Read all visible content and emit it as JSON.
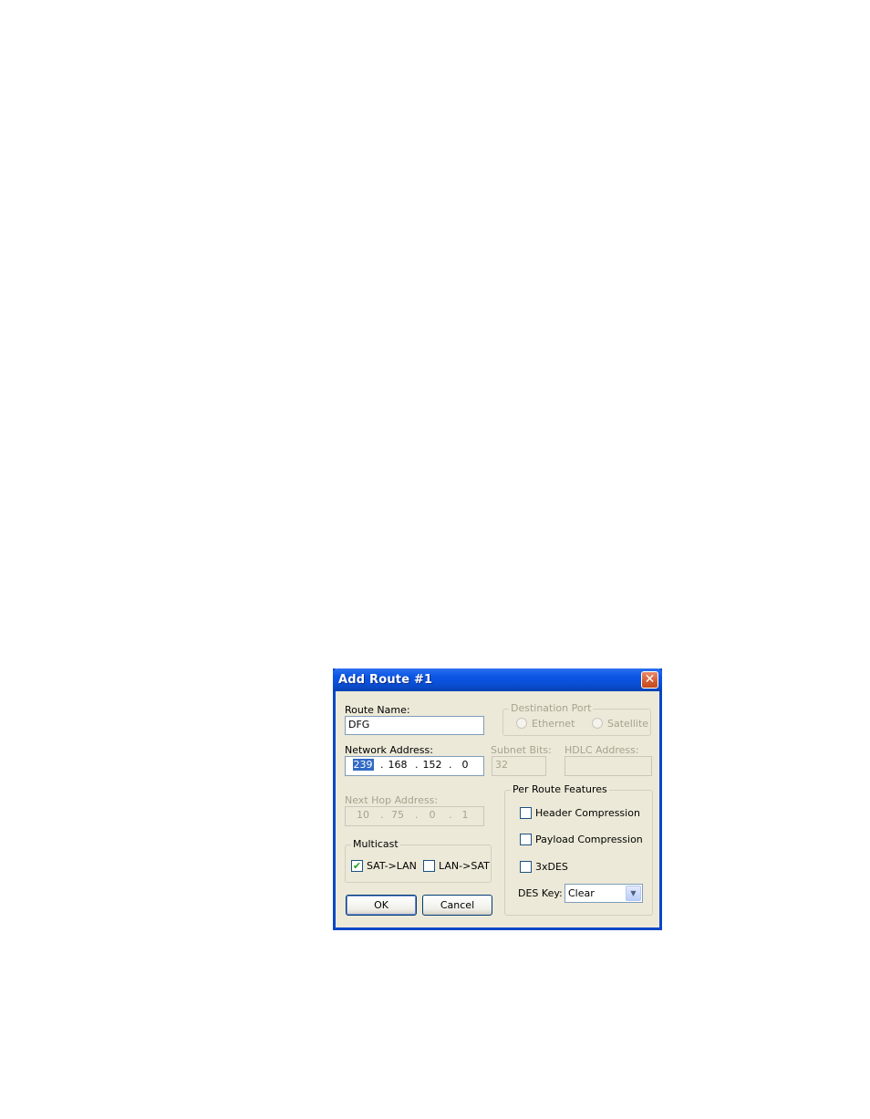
{
  "dialog": {
    "title": "Add Route #1",
    "close_glyph": "✕"
  },
  "route_name": {
    "label": "Route Name:",
    "value": "DFG"
  },
  "destination_port": {
    "label": "Destination Port",
    "options": [
      "Ethernet",
      "Satellite"
    ],
    "enabled": false
  },
  "network_address": {
    "label": "Network Address:",
    "octets": [
      "239",
      "168",
      "152",
      "0"
    ]
  },
  "subnet_bits": {
    "label": "Subnet Bits:",
    "value": "32",
    "enabled": false
  },
  "hdlc_address": {
    "label": "HDLC Address:",
    "value": "",
    "enabled": false
  },
  "next_hop": {
    "label": "Next Hop Address:",
    "octets": [
      "10",
      "75",
      "0",
      "1"
    ],
    "enabled": false
  },
  "multicast": {
    "label": "Multicast",
    "items": [
      {
        "label": "SAT->LAN",
        "checked": true
      },
      {
        "label": "LAN->SAT",
        "checked": false
      }
    ]
  },
  "per_route_features": {
    "label": "Per Route Features",
    "items": [
      {
        "label": "Header Compression",
        "checked": false
      },
      {
        "label": "Payload Compression",
        "checked": false
      },
      {
        "label": "3xDES",
        "checked": false
      }
    ],
    "des_key": {
      "label": "DES Key:",
      "value": "Clear"
    }
  },
  "buttons": {
    "ok": "OK",
    "cancel": "Cancel"
  },
  "glyphs": {
    "check": "✔",
    "dot": ".",
    "dropdown": "▼"
  }
}
